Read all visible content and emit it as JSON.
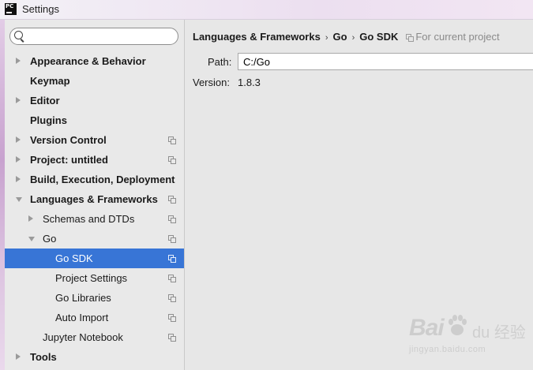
{
  "window": {
    "title": "Settings",
    "logo_text": "PC"
  },
  "sidebar": {
    "search": {
      "value": "",
      "placeholder": ""
    },
    "items": [
      {
        "label": "Appearance & Behavior",
        "bold": true,
        "level": 0,
        "arrow": "right",
        "copy": false
      },
      {
        "label": "Keymap",
        "bold": true,
        "level": 0,
        "arrow": "none",
        "copy": false
      },
      {
        "label": "Editor",
        "bold": true,
        "level": 0,
        "arrow": "right",
        "copy": false
      },
      {
        "label": "Plugins",
        "bold": true,
        "level": 0,
        "arrow": "none",
        "copy": false
      },
      {
        "label": "Version Control",
        "bold": true,
        "level": 0,
        "arrow": "right",
        "copy": true
      },
      {
        "label": "Project: untitled",
        "bold": true,
        "level": 0,
        "arrow": "right",
        "copy": true
      },
      {
        "label": "Build, Execution, Deployment",
        "bold": true,
        "level": 0,
        "arrow": "right",
        "copy": false
      },
      {
        "label": "Languages & Frameworks",
        "bold": true,
        "level": 0,
        "arrow": "down",
        "copy": true
      },
      {
        "label": "Schemas and DTDs",
        "bold": false,
        "level": 1,
        "arrow": "right",
        "copy": true
      },
      {
        "label": "Go",
        "bold": false,
        "level": 1,
        "arrow": "down",
        "copy": true
      },
      {
        "label": "Go SDK",
        "bold": false,
        "level": 2,
        "arrow": "none",
        "copy": true,
        "selected": true
      },
      {
        "label": "Project Settings",
        "bold": false,
        "level": 2,
        "arrow": "none",
        "copy": true
      },
      {
        "label": "Go Libraries",
        "bold": false,
        "level": 2,
        "arrow": "none",
        "copy": true
      },
      {
        "label": "Auto Import",
        "bold": false,
        "level": 2,
        "arrow": "none",
        "copy": true
      },
      {
        "label": "Jupyter Notebook",
        "bold": false,
        "level": 1,
        "arrow": "none",
        "copy": true
      },
      {
        "label": "Tools",
        "bold": true,
        "level": 0,
        "arrow": "right",
        "copy": false
      }
    ]
  },
  "content": {
    "breadcrumb": [
      "Languages & Frameworks",
      "Go",
      "Go SDK"
    ],
    "breadcrumb_separator": "›",
    "scope_text": "For current project",
    "path_label": "Path:",
    "path_value": "C:/Go",
    "version_label": "Version:",
    "version_value": "1.8.3"
  },
  "watermark": {
    "logo": "Bai",
    "logo_tail": "du",
    "text": "经验",
    "url": "jingyan.baidu.com"
  },
  "colors": {
    "selection": "#3875d6",
    "sidebar_bg": "#e9e9e9",
    "content_bg": "#e7e7e7"
  }
}
